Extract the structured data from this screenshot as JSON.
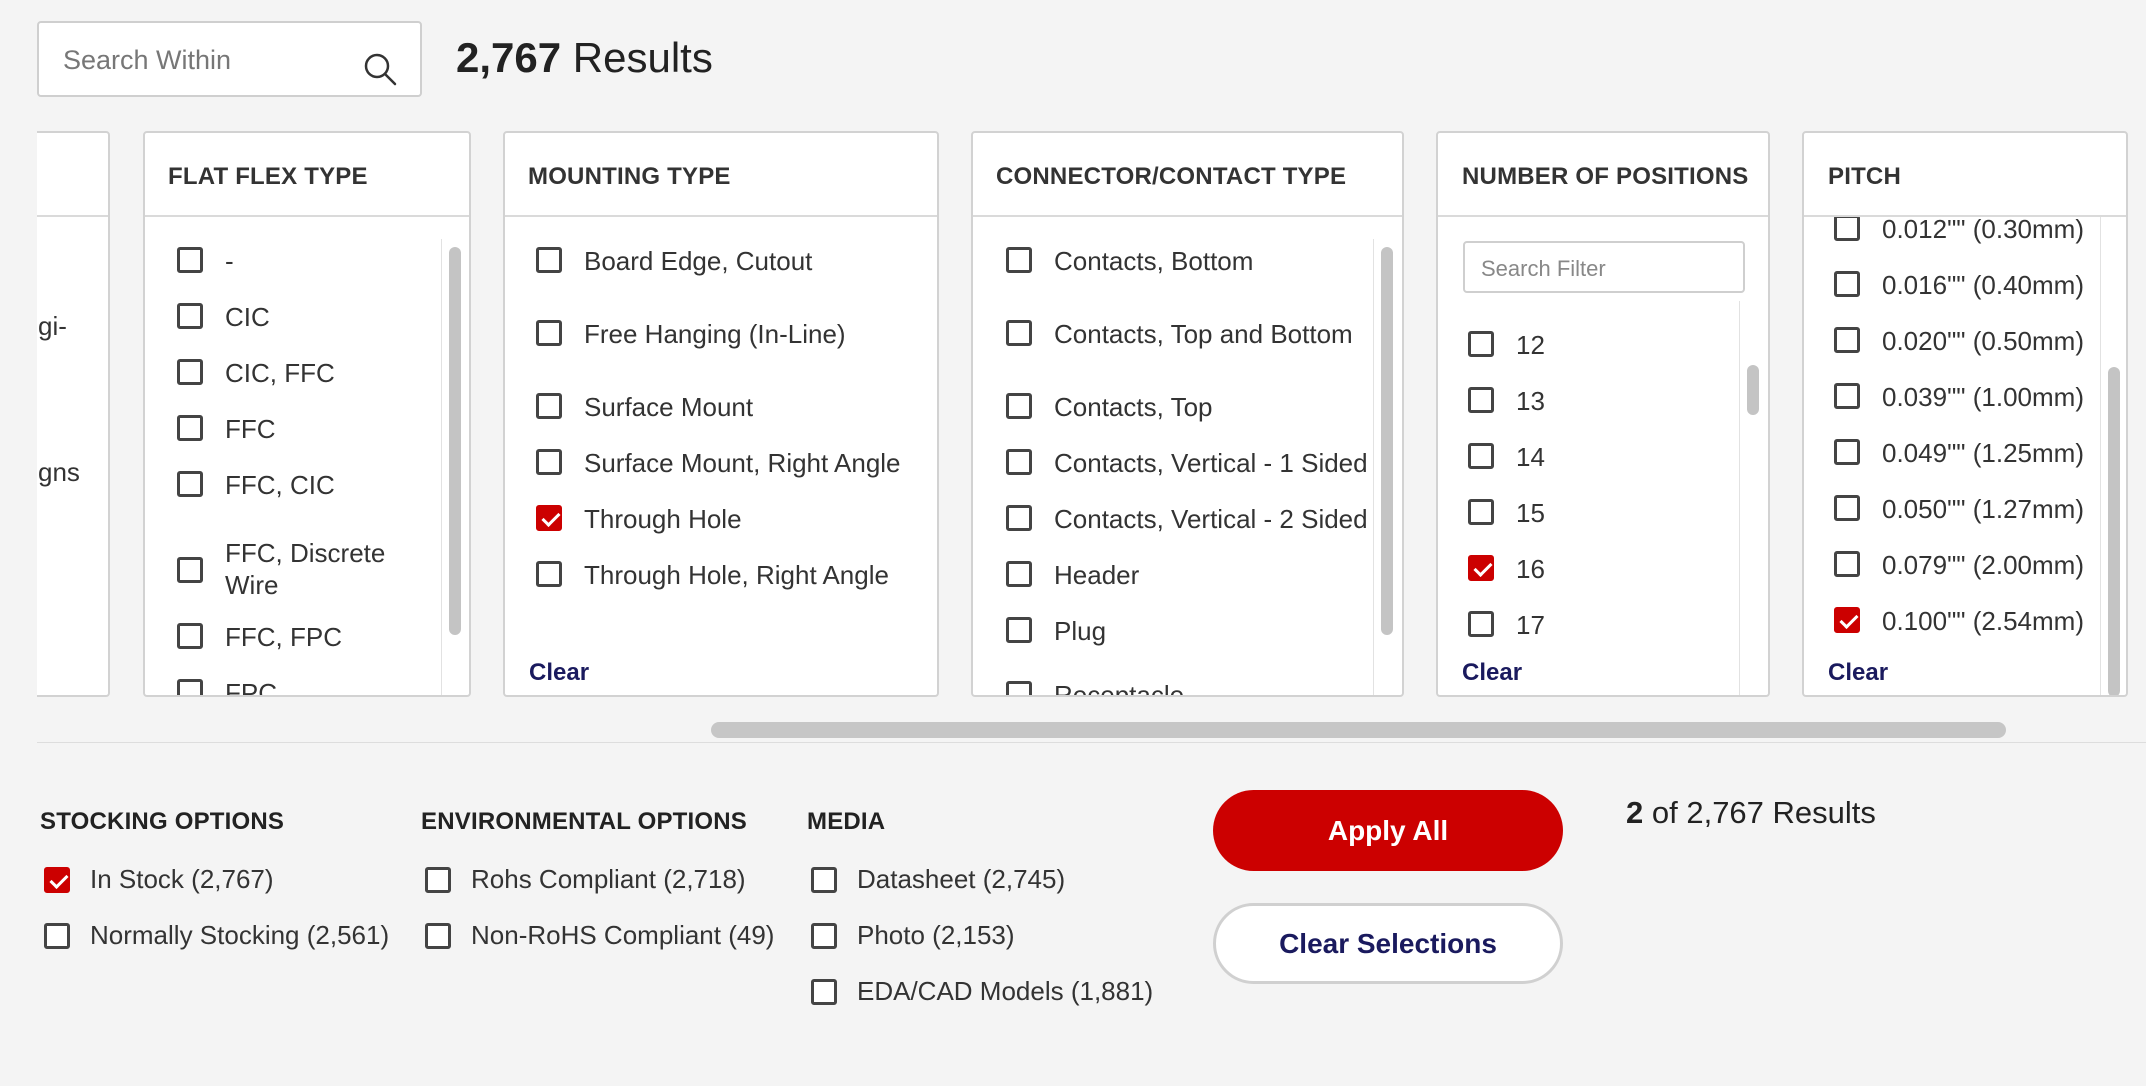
{
  "header": {
    "search_placeholder": "Search Within",
    "results_count": "2,767",
    "results_label": "Results"
  },
  "left_partial": {
    "fragments": [
      "gi-",
      "gns"
    ]
  },
  "flat_flex_type": {
    "title": "FLAT FLEX TYPE",
    "options": [
      {
        "label": "-",
        "checked": false
      },
      {
        "label": "CIC",
        "checked": false
      },
      {
        "label": "CIC, FFC",
        "checked": false
      },
      {
        "label": "FFC",
        "checked": false
      },
      {
        "label": "FFC, CIC",
        "checked": false
      },
      {
        "label": "FFC, Discrete",
        "label2": "Wire",
        "checked": false
      },
      {
        "label": "FFC, FPC",
        "checked": false
      },
      {
        "label": "FPC",
        "checked": false
      }
    ]
  },
  "mounting_type": {
    "title": "MOUNTING TYPE",
    "options": [
      {
        "label": "Board Edge, Cutout",
        "checked": false
      },
      {
        "label": "Free Hanging (In-Line)",
        "checked": false
      },
      {
        "label": "Surface Mount",
        "checked": false
      },
      {
        "label": "Surface Mount, Right Angle",
        "checked": false
      },
      {
        "label": "Through Hole",
        "checked": true
      },
      {
        "label": "Through Hole, Right Angle",
        "checked": false
      }
    ],
    "clear_label": "Clear"
  },
  "connector_contact_type": {
    "title": "CONNECTOR/CONTACT TYPE",
    "options": [
      {
        "label": "Contacts, Bottom",
        "checked": false
      },
      {
        "label": "Contacts, Top and Bottom",
        "checked": false
      },
      {
        "label": "Contacts, Top",
        "checked": false
      },
      {
        "label": "Contacts, Vertical - 1 Sided",
        "checked": false
      },
      {
        "label": "Contacts, Vertical - 2 Sided",
        "checked": false
      },
      {
        "label": "Header",
        "checked": false
      },
      {
        "label": "Plug",
        "checked": false
      },
      {
        "label": "Receptacle",
        "checked": false
      }
    ]
  },
  "number_of_positions": {
    "title": "NUMBER OF POSITIONS",
    "search_placeholder": "Search Filter",
    "options": [
      {
        "label": "12",
        "checked": false
      },
      {
        "label": "13",
        "checked": false
      },
      {
        "label": "14",
        "checked": false
      },
      {
        "label": "15",
        "checked": false
      },
      {
        "label": "16",
        "checked": true
      },
      {
        "label": "17",
        "checked": false
      }
    ],
    "clear_label": "Clear"
  },
  "pitch": {
    "title": "PITCH",
    "options": [
      {
        "label": "0.012\"\" (0.30mm)",
        "checked": false
      },
      {
        "label": "0.016\"\" (0.40mm)",
        "checked": false
      },
      {
        "label": "0.020\"\" (0.50mm)",
        "checked": false
      },
      {
        "label": "0.039\"\" (1.00mm)",
        "checked": false
      },
      {
        "label": "0.049\"\" (1.25mm)",
        "checked": false
      },
      {
        "label": "0.050\"\" (1.27mm)",
        "checked": false
      },
      {
        "label": "0.079\"\" (2.00mm)",
        "checked": false
      },
      {
        "label": "0.100\"\" (2.54mm)",
        "checked": true
      }
    ],
    "clear_label": "Clear"
  },
  "stocking_options": {
    "title": "STOCKING OPTIONS",
    "options": [
      {
        "label": "In Stock (2,767)",
        "checked": true
      },
      {
        "label": "Normally Stocking (2,561)",
        "checked": false
      }
    ]
  },
  "environmental_options": {
    "title": "ENVIRONMENTAL OPTIONS",
    "options": [
      {
        "label": "Rohs Compliant (2,718)",
        "checked": false
      },
      {
        "label": "Non-RoHS Compliant (49)",
        "checked": false
      }
    ]
  },
  "media": {
    "title": "MEDIA",
    "options": [
      {
        "label": "Datasheet (2,745)",
        "checked": false
      },
      {
        "label": "Photo (2,153)",
        "checked": false
      },
      {
        "label": "EDA/CAD Models (1,881)",
        "checked": false
      }
    ]
  },
  "actions": {
    "apply_label": "Apply All",
    "clear_label": "Clear Selections"
  },
  "summary": {
    "selected": "2",
    "of_text": "of 2,767 Results"
  },
  "colors": {
    "accent": "#cc0000",
    "link": "#1a1a5e",
    "background": "#f4f4f4"
  }
}
